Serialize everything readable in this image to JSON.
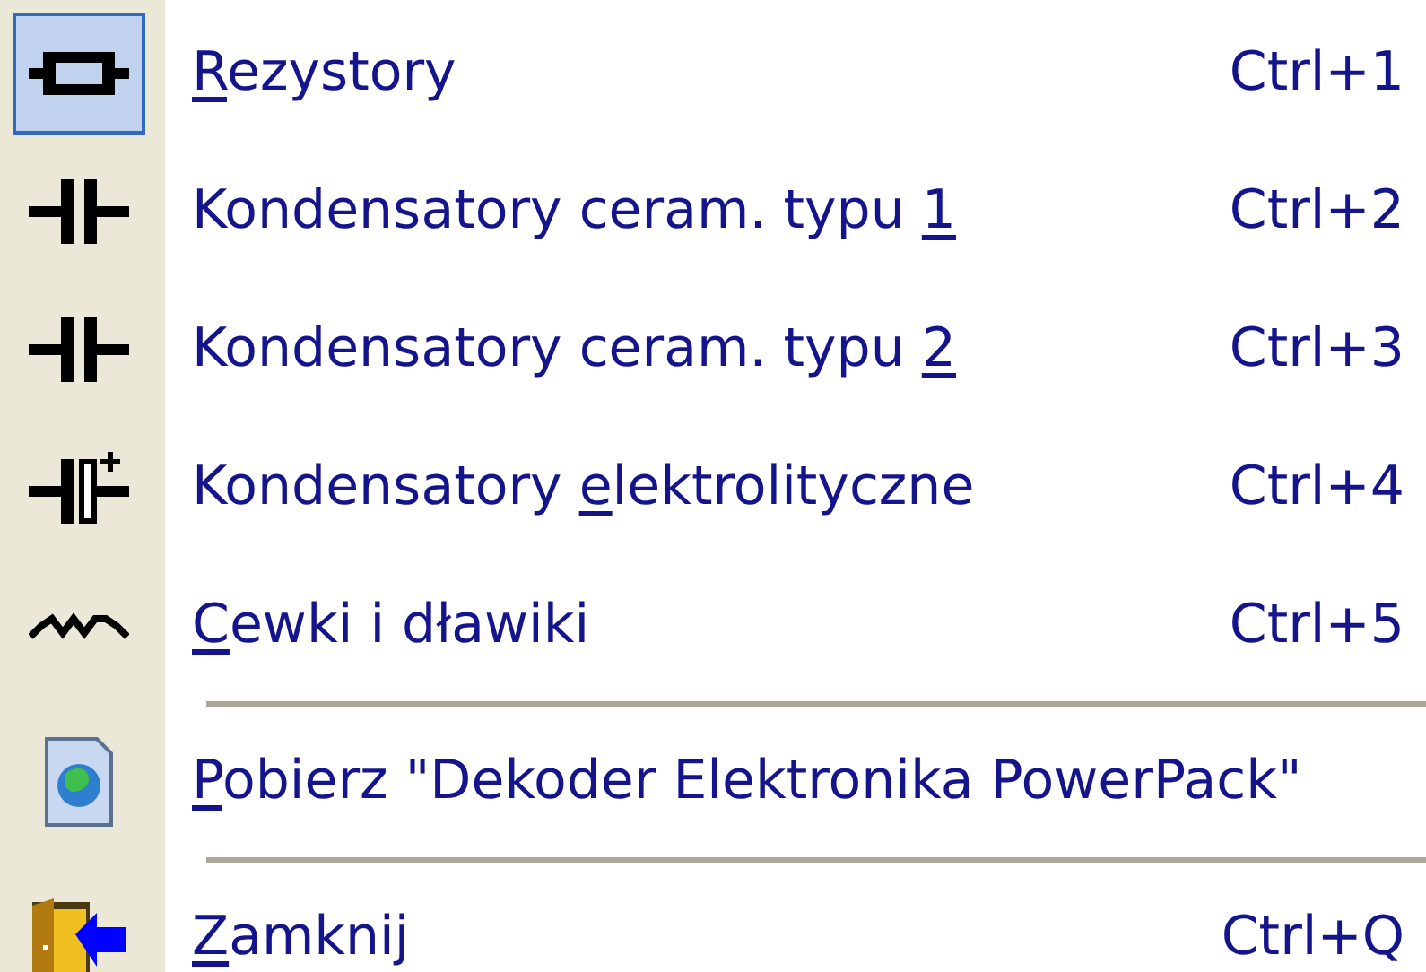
{
  "menu": {
    "items": [
      {
        "kind": "item",
        "selected": true,
        "label": [
          {
            "text": "R",
            "underline": true
          },
          {
            "text": "ezystory",
            "underline": false
          }
        ],
        "shortcut": "Ctrl+1"
      },
      {
        "kind": "item",
        "selected": false,
        "label": [
          {
            "text": "Kondensatory ceram. typu ",
            "underline": false
          },
          {
            "text": "1",
            "underline": true
          }
        ],
        "shortcut": "Ctrl+2"
      },
      {
        "kind": "item",
        "selected": false,
        "label": [
          {
            "text": "Kondensatory ceram. typu ",
            "underline": false
          },
          {
            "text": "2",
            "underline": true
          }
        ],
        "shortcut": "Ctrl+3"
      },
      {
        "kind": "item",
        "selected": false,
        "label": [
          {
            "text": "Kondensatory ",
            "underline": false
          },
          {
            "text": "e",
            "underline": true
          },
          {
            "text": "lektrolityczne",
            "underline": false
          }
        ],
        "shortcut": "Ctrl+4"
      },
      {
        "kind": "item",
        "selected": false,
        "label": [
          {
            "text": "C",
            "underline": true
          },
          {
            "text": "ewki i dławiki",
            "underline": false
          }
        ],
        "shortcut": "Ctrl+5"
      },
      {
        "kind": "separator"
      },
      {
        "kind": "item",
        "selected": false,
        "label": [
          {
            "text": "P",
            "underline": true
          },
          {
            "text": "obierz \"Dekoder Elektronika PowerPack\"",
            "underline": false
          }
        ]
      },
      {
        "kind": "separator"
      },
      {
        "kind": "item",
        "selected": false,
        "label": [
          {
            "text": "Z",
            "underline": true
          },
          {
            "text": "amknij",
            "underline": false
          }
        ],
        "shortcut": "Ctrl+Q"
      }
    ]
  }
}
